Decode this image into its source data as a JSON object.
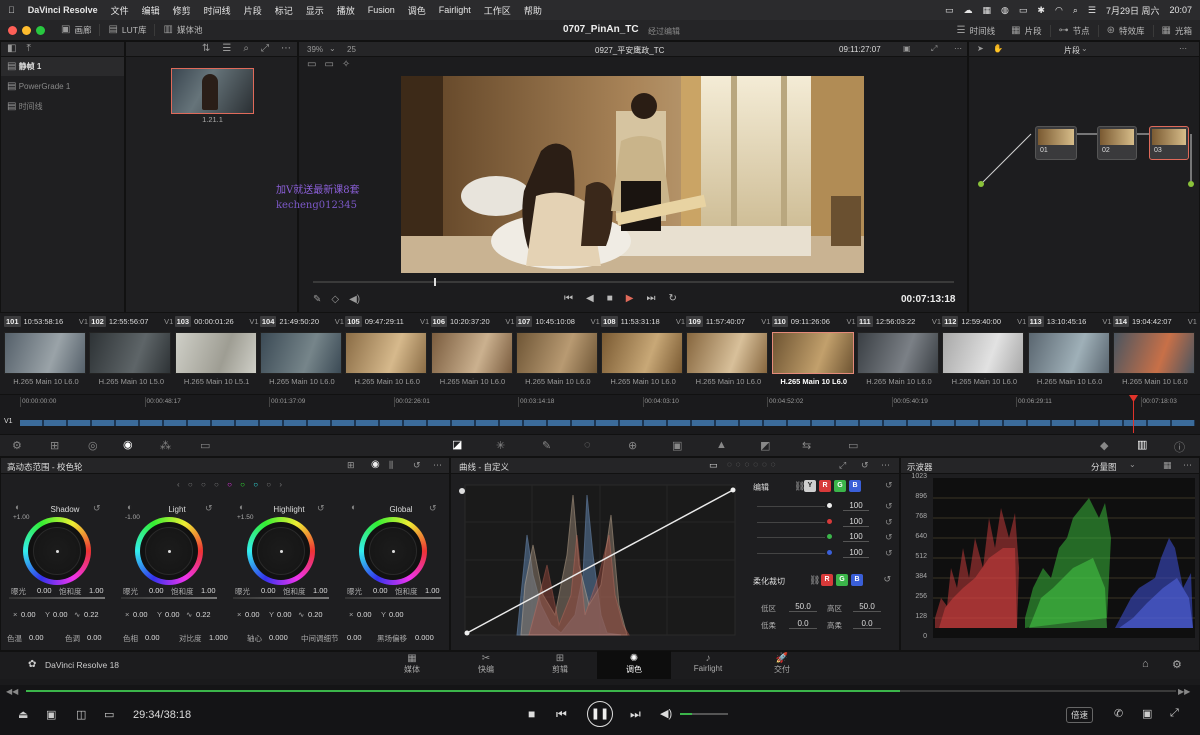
{
  "menubar": {
    "app": "DaVinci Resolve",
    "items": [
      "文件",
      "编辑",
      "修剪",
      "时间线",
      "片段",
      "标记",
      "显示",
      "播放",
      "Fusion",
      "调色",
      "Fairlight",
      "工作区",
      "帮助"
    ],
    "date": "7月29日 周六",
    "time": "20:07"
  },
  "titlebar": {
    "gallery": "画廊",
    "lut": "LUT库",
    "media_pool": "媒体池",
    "project": "0707_PinAn_TC",
    "status": "经过编辑",
    "timeline_btn": "时间线",
    "clips_btn": "片段",
    "nodes_btn": "节点",
    "effects_btn": "特效库",
    "lightbox_btn": "光箱"
  },
  "gallery": {
    "items": [
      "静帧 1",
      "PowerGrade 1",
      "时间线"
    ],
    "still_label": "1.21.1"
  },
  "viewer": {
    "zoom": "39%",
    "num": "25",
    "timeline_name": "0927_平安鹰政_TC",
    "timecode_top": "09:11:27:07",
    "timecode": "00:07:13:18",
    "overlay_lines": [
      "加V就送最新课8套",
      "kecheng012345"
    ]
  },
  "nodes": {
    "mode": "片段",
    "items": [
      "01",
      "02",
      "03"
    ]
  },
  "clips": [
    {
      "num": "101",
      "tc": "10:53:58:16",
      "codec": "H.265 Main 10 L6.0",
      "colors": [
        "#55606a",
        "#9aa3a8"
      ]
    },
    {
      "num": "102",
      "tc": "12:55:56:07",
      "codec": "H.265 Main 10 L5.0",
      "colors": [
        "#2e3336",
        "#5e6568"
      ]
    },
    {
      "num": "103",
      "tc": "00:00:01:26",
      "codec": "H.265 Main 10 L5.1",
      "colors": [
        "#cfcfc7",
        "#9e9d93"
      ]
    },
    {
      "num": "104",
      "tc": "21:49:50:20",
      "codec": "H.265 Main 10 L6.0",
      "colors": [
        "#3b4a55",
        "#76858a"
      ]
    },
    {
      "num": "105",
      "tc": "09:47:29:11",
      "codec": "H.265 Main 10 L6.0",
      "colors": [
        "#8a6c45",
        "#d6b98c"
      ]
    },
    {
      "num": "106",
      "tc": "10:20:37:20",
      "codec": "H.265 Main 10 L6.0",
      "colors": [
        "#7a5c3e",
        "#cbb18f"
      ]
    },
    {
      "num": "107",
      "tc": "10:45:10:08",
      "codec": "H.265 Main 10 L6.0",
      "colors": [
        "#6f5636",
        "#b89a72"
      ]
    },
    {
      "num": "108",
      "tc": "11:53:31:18",
      "codec": "H.265 Main 10 L6.0",
      "colors": [
        "#7a5a32",
        "#c8a877"
      ]
    },
    {
      "num": "109",
      "tc": "11:57:40:07",
      "codec": "H.265 Main 10 L6.0",
      "colors": [
        "#86663e",
        "#d8c09a"
      ]
    },
    {
      "num": "110",
      "tc": "09:11:26:06",
      "codec": "H.265 Main 10 L6.0",
      "colors": [
        "#6e5432",
        "#c2a06c"
      ],
      "selected": true
    },
    {
      "num": "111",
      "tc": "12:56:03:22",
      "codec": "H.265 Main 10 L6.0",
      "colors": [
        "#3a3f44",
        "#7b8086"
      ]
    },
    {
      "num": "112",
      "tc": "12:59:40:00",
      "codec": "H.265 Main 10 L6.0",
      "colors": [
        "#a8a8a8",
        "#e2e2e2"
      ]
    },
    {
      "num": "113",
      "tc": "13:10:45:16",
      "codec": "H.265 Main 10 L6.0",
      "colors": [
        "#5a6670",
        "#9fb0b8"
      ]
    },
    {
      "num": "114",
      "tc": "19:04:42:07",
      "codec": "H.265 Main 10 L6.0",
      "colors": [
        "#4a5560",
        "#c87048"
      ]
    }
  ],
  "ruler": [
    "00:00:00:00",
    "00:00:48:17",
    "00:01:37:09",
    "00:02:26:01",
    "00:03:14:18",
    "00:04:03:10",
    "00:04:52:02",
    "00:05:40:19",
    "00:06:29:11",
    "00:07:18:03"
  ],
  "track": "V1",
  "wheels_panel": {
    "title": "高动态范围 - 校色轮",
    "wheels": [
      {
        "name": "Shadow",
        "badge": "+1.00",
        "exp": "0.00",
        "sat": "1.00",
        "x": "0.00",
        "y": "0.00",
        "z": "0.22"
      },
      {
        "name": "Light",
        "badge": "-1.00",
        "exp": "0.00",
        "sat": "1.00",
        "x": "0.00",
        "y": "0.00",
        "z": "0.22"
      },
      {
        "name": "Highlight",
        "badge": "+1.50",
        "exp": "0.00",
        "sat": "1.00",
        "x": "0.00",
        "y": "0.00",
        "z": "0.20"
      },
      {
        "name": "Global",
        "badge": "",
        "exp": "0.00",
        "sat": "1.00",
        "x": "0.00",
        "y": "0.00",
        "z": ""
      }
    ],
    "exp_label": "曝光",
    "sat_label": "饱和度",
    "bottom": [
      {
        "label": "色温",
        "value": "0.00"
      },
      {
        "label": "色调",
        "value": "0.00"
      },
      {
        "label": "色相",
        "value": "0.00"
      },
      {
        "label": "对比度",
        "value": "1.000"
      },
      {
        "label": "轴心",
        "value": "0.000"
      },
      {
        "label": "中间调细节",
        "value": "0.00"
      },
      {
        "label": "黑场偏移",
        "value": "0.000"
      }
    ]
  },
  "curves_panel": {
    "title": "曲线 - 自定义",
    "edit_label": "编辑",
    "values": [
      "100",
      "100",
      "100",
      "100"
    ],
    "soft_clip": "柔化裁切",
    "low": "低区",
    "low_val": "50.0",
    "high": "高区",
    "high_val": "50.0",
    "low_soft": "低柔",
    "low_soft_val": "0.0",
    "high_soft": "高柔",
    "high_soft_val": "0.0",
    "chips": [
      "Y",
      "R",
      "G",
      "B"
    ]
  },
  "scope_panel": {
    "title": "示波器",
    "mode": "分量图",
    "ticks": [
      "1023",
      "896",
      "768",
      "640",
      "512",
      "384",
      "256",
      "128",
      "0"
    ]
  },
  "pages": [
    {
      "icon": "▦",
      "label": "媒体"
    },
    {
      "icon": "✂",
      "label": "快编"
    },
    {
      "icon": "⊞",
      "label": "剪辑"
    },
    {
      "icon": "✺",
      "label": "调色",
      "active": true
    },
    {
      "icon": "♪",
      "label": "Fairlight"
    },
    {
      "icon": "🚀",
      "label": "交付"
    }
  ],
  "brand": "DaVinci Resolve 18",
  "player": {
    "time": "29:34/38:18",
    "speed": "倍速",
    "progress": 0.76
  },
  "colors": {
    "accent": "#e06a5a",
    "bg": "#1f1f21",
    "green": "#3bb54a"
  }
}
